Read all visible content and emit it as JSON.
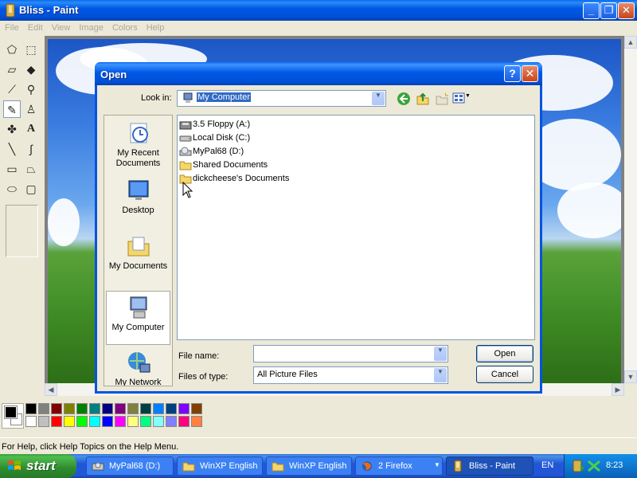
{
  "window": {
    "title": "Bliss - Paint",
    "controls": [
      "_",
      "❐",
      "✕"
    ]
  },
  "menu": {
    "items": [
      "File",
      "Edit",
      "View",
      "Image",
      "Colors",
      "Help"
    ]
  },
  "toolbox": {
    "tools": [
      "free-form-select",
      "select",
      "eraser",
      "fill",
      "pick-color",
      "magnifier",
      "pencil",
      "brush",
      "airbrush",
      "text",
      "line",
      "curve",
      "rectangle",
      "polygon",
      "ellipse",
      "rounded-rectangle"
    ],
    "active": "pencil"
  },
  "palette": {
    "foreground": "#000000",
    "background": "#ffffff",
    "row1": [
      "#000000",
      "#808080",
      "#800000",
      "#808000",
      "#008000",
      "#008080",
      "#000080",
      "#800080",
      "#808040",
      "#004040",
      "#0080ff",
      "#004080",
      "#8000ff",
      "#804000"
    ],
    "row2": [
      "#ffffff",
      "#c0c0c0",
      "#ff0000",
      "#ffff00",
      "#00ff00",
      "#00ffff",
      "#0000ff",
      "#ff00ff",
      "#ffff80",
      "#00ff80",
      "#80ffff",
      "#8080ff",
      "#ff0080",
      "#ff8040"
    ]
  },
  "status": {
    "text": "For Help, click Help Topics on the Help Menu."
  },
  "dialog": {
    "title": "Open",
    "help_btn": "?",
    "close_btn": "✕",
    "look_in_label": "Look in:",
    "look_in_value": "My Computer",
    "places": [
      {
        "label": "My Recent Documents",
        "icon": "recent-documents-icon"
      },
      {
        "label": "Desktop",
        "icon": "desktop-icon"
      },
      {
        "label": "My Documents",
        "icon": "my-documents-icon"
      },
      {
        "label": "My Computer",
        "icon": "my-computer-icon"
      },
      {
        "label": "My Network",
        "icon": "my-network-icon"
      }
    ],
    "selected_place": "My Computer",
    "files": [
      {
        "label": "3.5 Floppy (A:)",
        "icon": "floppy-icon"
      },
      {
        "label": "Local Disk (C:)",
        "icon": "disk-icon"
      },
      {
        "label": "MyPal68 (D:)",
        "icon": "cd-drive-icon"
      },
      {
        "label": "Shared Documents",
        "icon": "folder-icon"
      },
      {
        "label": "dickcheese's Documents",
        "icon": "folder-icon"
      }
    ],
    "file_name_label": "File name:",
    "file_name_value": "",
    "file_type_label": "Files of type:",
    "file_type_value": "All Picture Files",
    "open_btn": "Open",
    "cancel_btn": "Cancel"
  },
  "taskbar": {
    "start_label": "start",
    "tasks": [
      {
        "label": "MyPal68 (D:)",
        "icon": "cd-drive-icon"
      },
      {
        "label": "WinXP English",
        "icon": "folder-icon"
      },
      {
        "label": "WinXP English",
        "icon": "folder-icon"
      },
      {
        "label": "2 Firefox",
        "icon": "firefox-icon"
      },
      {
        "label": "Bliss - Paint",
        "icon": "paint-icon"
      }
    ],
    "active_task": "Bliss - Paint",
    "language": "EN",
    "clock": "8:23"
  }
}
